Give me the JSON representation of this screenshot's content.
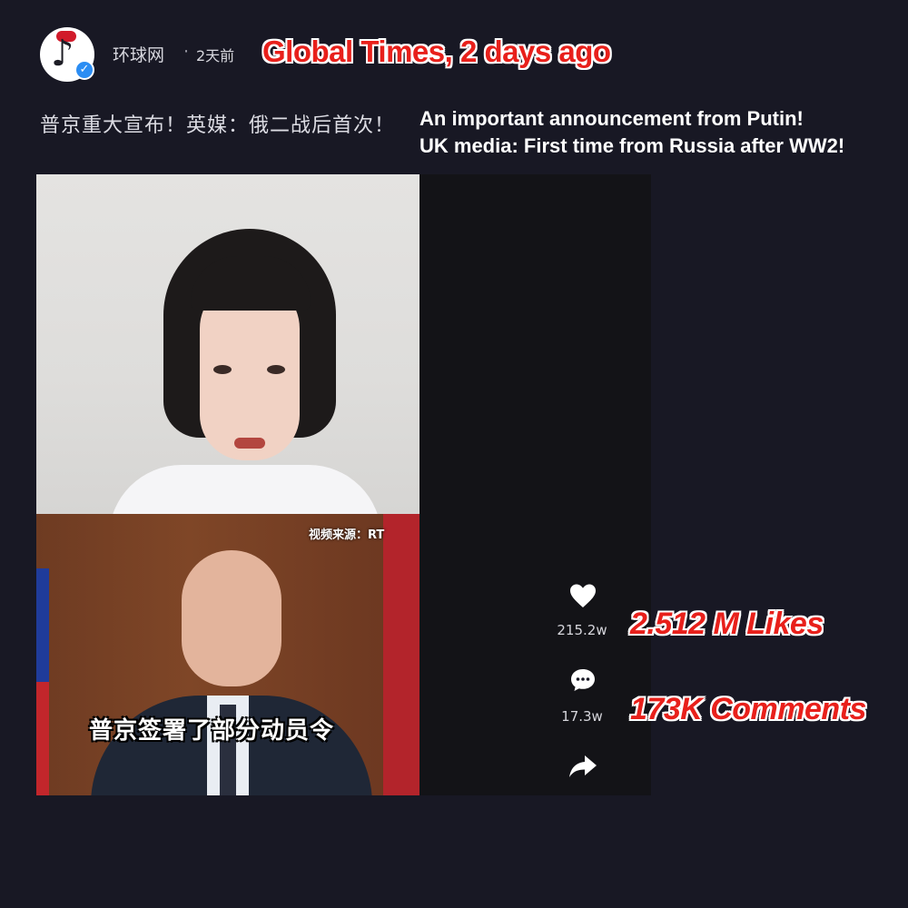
{
  "header": {
    "author": "环球网",
    "separator": "·",
    "time_ago": "2天前",
    "caption_en": "Global Times, 2 days ago"
  },
  "post": {
    "title_cn": "普京重大宣布！英媒：俄二战后首次！",
    "title_en_line1": "An important announcement from Putin!",
    "title_en_line2": "UK media: First time from Russia after WW2!"
  },
  "video": {
    "source_label": "视频来源：RT",
    "subtitle": "普京签署了部分动员令"
  },
  "actions": {
    "like_count": "215.2w",
    "comment_count": "17.3w",
    "likes_caption": "2.512 M Likes",
    "comments_caption": "173K  Comments"
  },
  "icons": {
    "like": "heart-icon",
    "comment": "comment-icon",
    "share": "share-icon",
    "verified": "verified-badge-icon"
  },
  "colors": {
    "background": "#181824",
    "caption_red": "#e8201b",
    "verified_blue": "#2b8df3"
  }
}
